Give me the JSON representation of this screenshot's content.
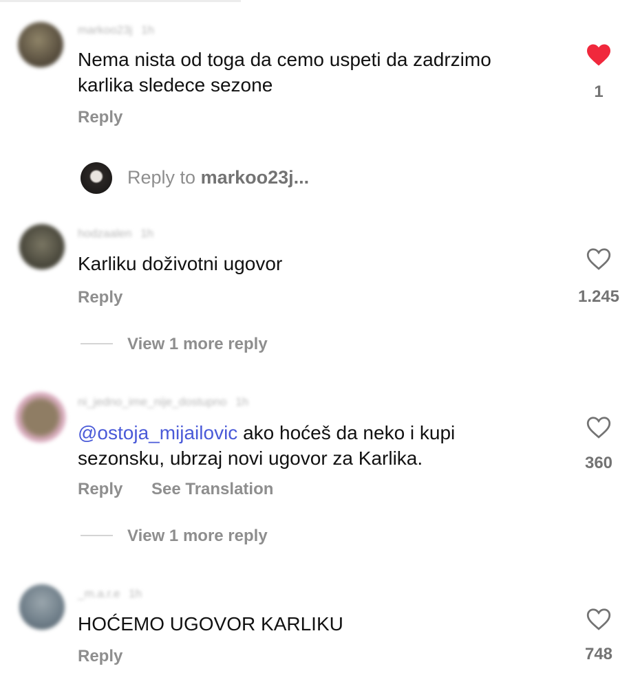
{
  "comments": [
    {
      "username": "markoo23j",
      "time": "1h",
      "avatar_color": "#6b6048",
      "text": "Nema nista od toga da cemo uspeti da zadrzimo karlika sledece sezone",
      "line1": "Nema nista od toga da cemo uspeti da zadrzimo",
      "line2": "karlika sledece sezone",
      "reply_label": "Reply",
      "liked": true,
      "likes": "1"
    },
    {
      "username": "hodzaalen",
      "time": "1h",
      "avatar_color": "#5d5a4c",
      "text": "Karliku doživotni ugovor",
      "reply_label": "Reply",
      "liked": false,
      "likes": "1.245",
      "view_more": "View 1 more reply"
    },
    {
      "username": "ni_jedno_ime_nije_dostupno",
      "time": "1h",
      "avatar_color": "#8a7560",
      "mention": "@ostoja_mijailovic",
      "line1_rest": " ako hoćeš da neko i kupi",
      "line2": "sezonsku, ubrzaj novi ugovor za Karlika.",
      "reply_label": "Reply",
      "translation_label": "See Translation",
      "liked": false,
      "likes": "360",
      "view_more": "View 1 more reply"
    },
    {
      "username": "_m.a.r.e",
      "time": "1h",
      "avatar_color": "#7d8a95",
      "text": "HOĆEMO UGOVOR KARLIKU",
      "reply_label": "Reply",
      "liked": false,
      "likes": "748"
    }
  ],
  "reply_prompt": {
    "prefix": "Reply to ",
    "target": "markoo23j..."
  },
  "colors": {
    "heart_liked": "#f0283c",
    "heart_outline": "#737373",
    "mention": "#4a5ad8",
    "secondary_text": "#8e8e8e"
  }
}
